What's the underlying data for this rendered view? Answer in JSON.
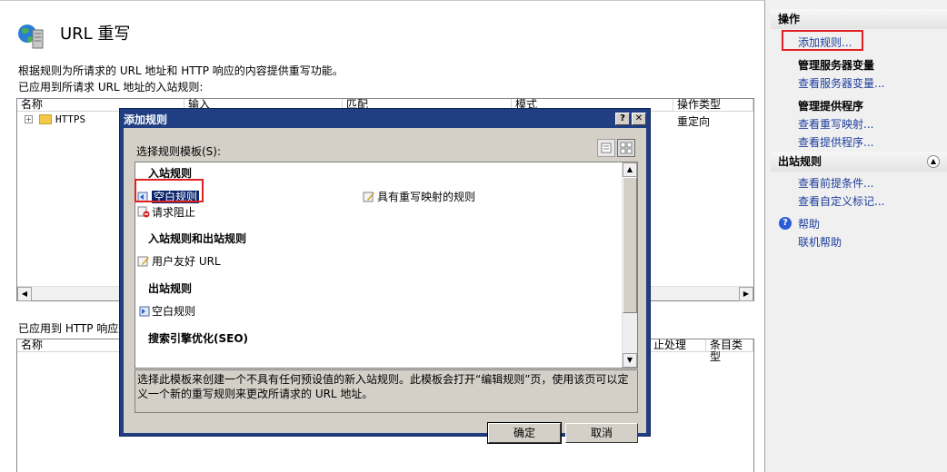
{
  "main": {
    "title": "URL 重写",
    "description": "根据规则为所请求的 URL 地址和 HTTP 响应的内容提供重写功能。",
    "inbound_label": "已应用到所请求 URL 地址的入站规则:",
    "inbound_columns": [
      "名称",
      "输入",
      "匹配",
      "模式",
      "操作类型"
    ],
    "inbound_rows": [
      {
        "name": "HTTPS",
        "action": "重定向"
      }
    ],
    "outbound_label": "已应用到 HTTP 响应头",
    "outbound_columns": [
      "名称",
      "止处理",
      "条目类型"
    ]
  },
  "actions": {
    "header": "操作",
    "add_rule": "添加规则...",
    "server_vars_title": "管理服务器变量",
    "view_server_vars": "查看服务器变量...",
    "providers_title": "管理提供程序",
    "view_rewrite_maps": "查看重写映射...",
    "view_providers": "查看提供程序...",
    "outbound_header": "出站规则",
    "view_preconditions": "查看前提条件...",
    "view_custom_tags": "查看自定义标记...",
    "help": "帮助",
    "online_help": "联机帮助"
  },
  "dialog": {
    "title": "添加规则",
    "help_btn": "?",
    "close_btn": "✕",
    "select_label": "选择规则模板(S):",
    "groups": {
      "inbound": "入站规则",
      "in_out": "入站规则和出站规则",
      "outbound": "出站规则",
      "seo": "搜索引擎优化(SEO)"
    },
    "items": {
      "blank_rule": "空白规则",
      "rule_with_map": "具有重写映射的规则",
      "request_block": "请求阻止",
      "user_friendly": "用户友好 URL",
      "outbound_blank": "空白规则"
    },
    "description": "选择此模板来创建一个不具有任何预设值的新入站规则。此模板会打开“编辑规则”页，使用该页可以定义一个新的重写规则来更改所请求的 URL 地址。",
    "ok": "确定",
    "cancel": "取消"
  },
  "colors": {
    "dialog_title_bg": "#1f3f82",
    "link": "#1d3e9c",
    "highlight_box": "#e02020",
    "selection": "#0a246a"
  }
}
